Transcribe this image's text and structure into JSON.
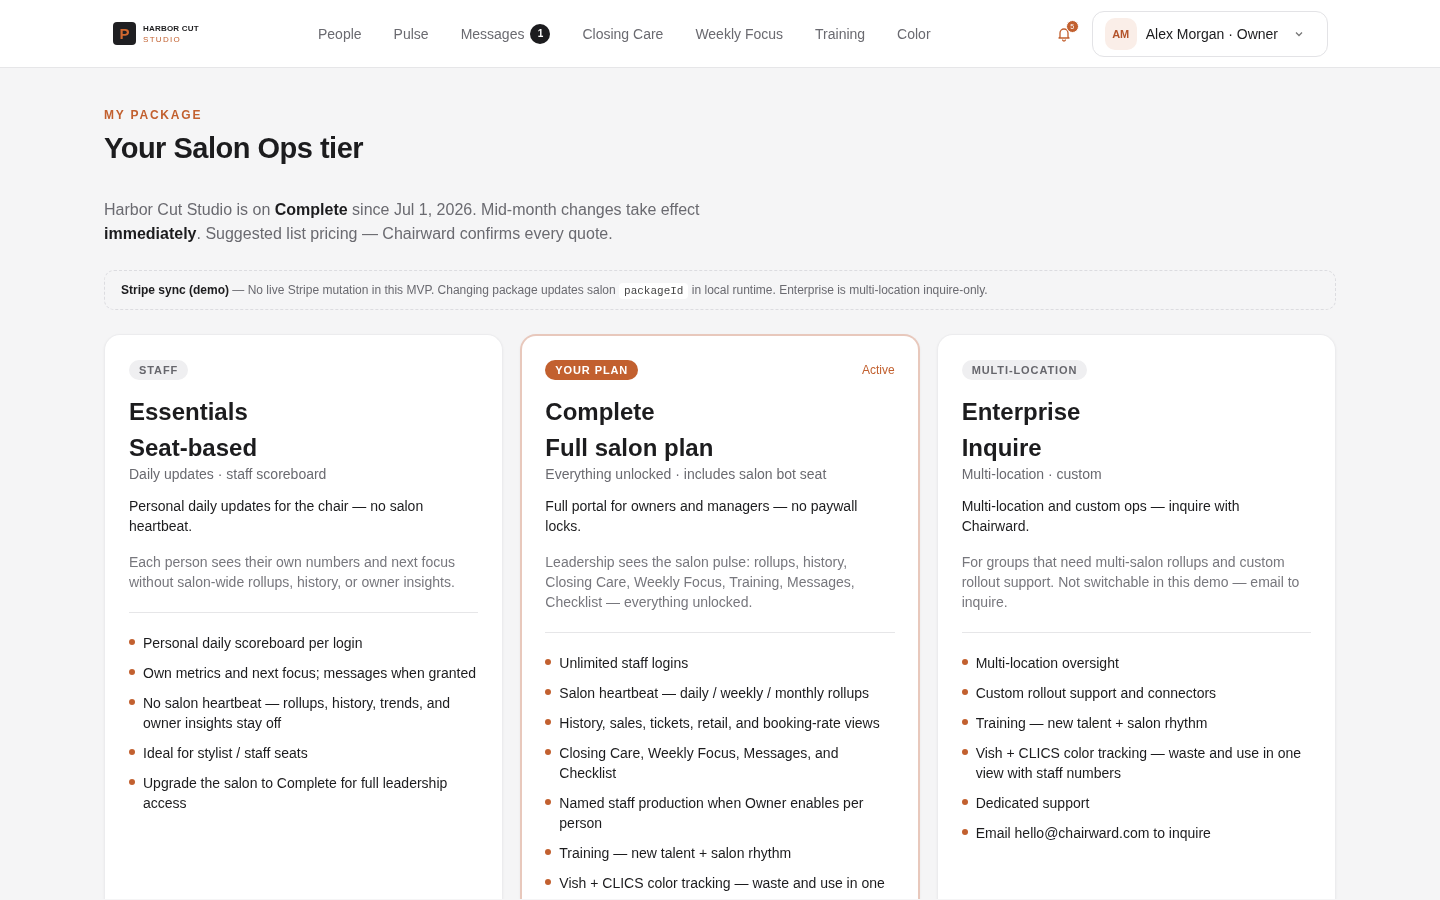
{
  "brand": {
    "mark": "P",
    "name": "HARBOR CUT",
    "sub": "STUDIO"
  },
  "nav": [
    {
      "label": "People"
    },
    {
      "label": "Pulse"
    },
    {
      "label": "Messages",
      "badge": "1"
    },
    {
      "label": "Closing Care"
    },
    {
      "label": "Weekly Focus"
    },
    {
      "label": "Training"
    },
    {
      "label": "Color"
    }
  ],
  "notifications": {
    "count": "5"
  },
  "user": {
    "initials": "AM",
    "label": "Alex Morgan · Owner"
  },
  "eyebrow": "MY PACKAGE",
  "title": "Your Salon Ops tier",
  "intro": "Harbor Cut Studio is on **Complete** since Jul 1, 2026. Mid-month changes take effect **immediately**. Suggested list pricing — Chairward confirms every quote.",
  "note": {
    "lead": "Stripe sync (demo)",
    "before": " — No live Stripe mutation in this MVP. Changing package updates salon ",
    "code": "packageId",
    "after": " in local runtime. Enterprise is multi-location inquire-only."
  },
  "plans": [
    {
      "tag": "STAFF",
      "selected": false,
      "name": "Essentials",
      "subtitle": "Seat-based",
      "meta": "Daily updates · staff scoreboard",
      "summary": "Personal daily updates for the chair — no salon heartbeat.",
      "detail": "Each person sees their own numbers and next focus without salon-wide rollups, history, or owner insights.",
      "features": [
        "Personal daily scoreboard per login",
        "Own metrics and next focus; messages when granted",
        "No salon heartbeat — rollups, history, trends, and owner insights stay off",
        "Ideal for stylist / staff seats",
        "Upgrade the salon to Complete for full leadership access"
      ]
    },
    {
      "tag": "YOUR PLAN",
      "selected": true,
      "status": "Active",
      "name": "Complete",
      "subtitle": "Full salon plan",
      "meta": "Everything unlocked · includes salon bot seat",
      "summary": "Full portal for owners and managers — no paywall locks.",
      "detail": "Leadership sees the salon pulse: rollups, history, Closing Care, Weekly Focus, Training, Messages, Checklist — everything unlocked.",
      "features": [
        "Unlimited staff logins",
        "Salon heartbeat — daily / weekly / monthly rollups",
        "History, sales, tickets, retail, and booking-rate views",
        "Closing Care, Weekly Focus, Messages, and Checklist",
        "Named staff production when Owner enables per person",
        "Training — new talent + salon rhythm",
        "Vish + CLICS color tracking — waste and use in one"
      ]
    },
    {
      "tag": "MULTI-LOCATION",
      "selected": false,
      "name": "Enterprise",
      "subtitle": "Inquire",
      "meta": "Multi-location · custom",
      "summary": "Multi-location and custom ops — inquire with Chairward.",
      "detail": "For groups that need multi-salon rollups and custom rollout support. Not switchable in this demo — email to inquire.",
      "features": [
        "Multi-location oversight",
        "Custom rollout support and connectors",
        "Training — new talent + salon rhythm",
        "Vish + CLICS color tracking — waste and use in one view with staff numbers",
        "Dedicated support",
        "Email hello@chairward.com to inquire"
      ]
    }
  ]
}
